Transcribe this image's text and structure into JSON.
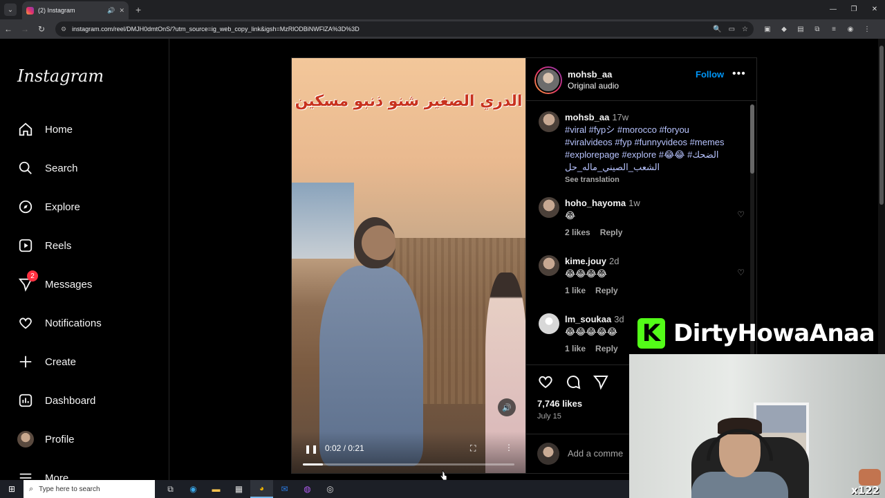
{
  "browser": {
    "tab_title": "(2) Instagram",
    "url": "instagram.com/reel/DMJH0dmtOnS/?utm_source=ig_web_copy_link&igsh=MzRlODBiNWFlZA%3D%3D"
  },
  "sidebar": {
    "logo": "Instagram",
    "items": [
      {
        "label": "Home",
        "icon": "home-icon"
      },
      {
        "label": "Search",
        "icon": "search-icon"
      },
      {
        "label": "Explore",
        "icon": "compass-icon"
      },
      {
        "label": "Reels",
        "icon": "reels-icon"
      },
      {
        "label": "Messages",
        "icon": "messages-icon",
        "badge": "2"
      },
      {
        "label": "Notifications",
        "icon": "heart-icon"
      },
      {
        "label": "Create",
        "icon": "plus-icon"
      },
      {
        "label": "Dashboard",
        "icon": "dashboard-icon"
      },
      {
        "label": "Profile",
        "icon": "avatar"
      },
      {
        "label": "More",
        "icon": "menu-icon"
      }
    ]
  },
  "video": {
    "caption_text": "الدري الصغير شنو ذنبو مسكين",
    "time": "0:02 / 0:21",
    "progress": 0.095
  },
  "post": {
    "username": "mohsb_aa",
    "audio": "Original audio",
    "follow_label": "Follow",
    "comments": [
      {
        "user": "mohsb_aa",
        "time": "17w",
        "text": "#viral #fypシ #morocco #foryou #viralvideos #fyp #funnyvideos #memes #explorepage #explore #الضحك# 😂😂 الشعب_الصيني_ماله_حل",
        "see_translation": "See translation"
      },
      {
        "user": "hoho_hayoma",
        "time": "1w",
        "text": "😂",
        "likes": "2 likes",
        "reply": "Reply"
      },
      {
        "user": "kime.jouy",
        "time": "2d",
        "text": "😂😂😂😂",
        "likes": "1 like",
        "reply": "Reply"
      },
      {
        "user": "lm_soukaa",
        "time": "3d",
        "text": "😂😂😂😂😂",
        "likes": "1 like",
        "reply": "Reply"
      }
    ],
    "likes": "7,746 likes",
    "date": "July 15",
    "add_comment_placeholder": "Add a comme"
  },
  "overlay": {
    "streamer": "DirtyHowaAnaa",
    "k_logo": "K",
    "counter": "x122"
  },
  "taskbar": {
    "search_placeholder": "Type here to search"
  }
}
